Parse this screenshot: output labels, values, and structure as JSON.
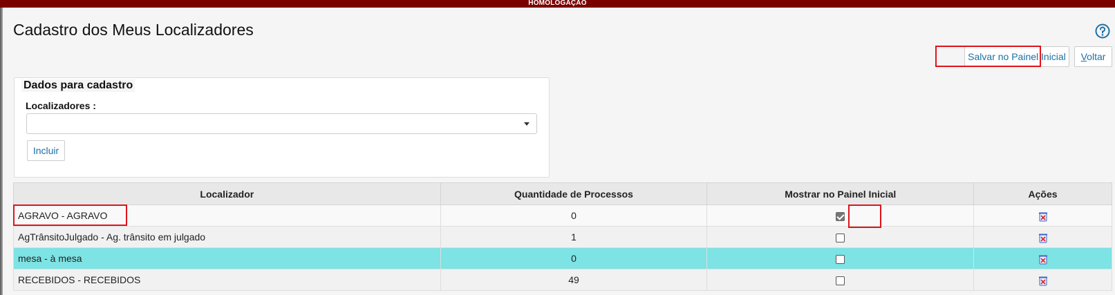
{
  "env_banner": "HOMOLOGAÇÃO",
  "page": {
    "title": "Cadastro dos Meus Localizadores",
    "help_icon": "help-circle-icon"
  },
  "toolbar": {
    "save_label": "Salvar no Painel Inicial",
    "back_first": "V",
    "back_rest": "oltar"
  },
  "form": {
    "legend": "Dados para cadastro",
    "localizadores_label": "Localizadores :",
    "select_value": "",
    "include_label": "Incluir"
  },
  "table": {
    "headers": [
      "Localizador",
      "Quantidade de Processos",
      "Mostrar no Painel Inicial",
      "Ações"
    ],
    "rows": [
      {
        "localizador": "AGRAVO - AGRAVO",
        "quantidade": "0",
        "mostrar": true
      },
      {
        "localizador": "AgTrânsitoJulgado - Ag. trânsito em julgado",
        "quantidade": "1",
        "mostrar": false
      },
      {
        "localizador": "mesa - à mesa",
        "quantidade": "0",
        "mostrar": false
      },
      {
        "localizador": "RECEBIDOS - RECEBIDOS",
        "quantidade": "49",
        "mostrar": false
      }
    ],
    "action_icon": "trash-icon"
  },
  "colors": {
    "env_bar": "#7a0000",
    "link": "#1a6fa6",
    "highlight_row": "#7de3e4",
    "annotation_red": "#e0131a"
  }
}
